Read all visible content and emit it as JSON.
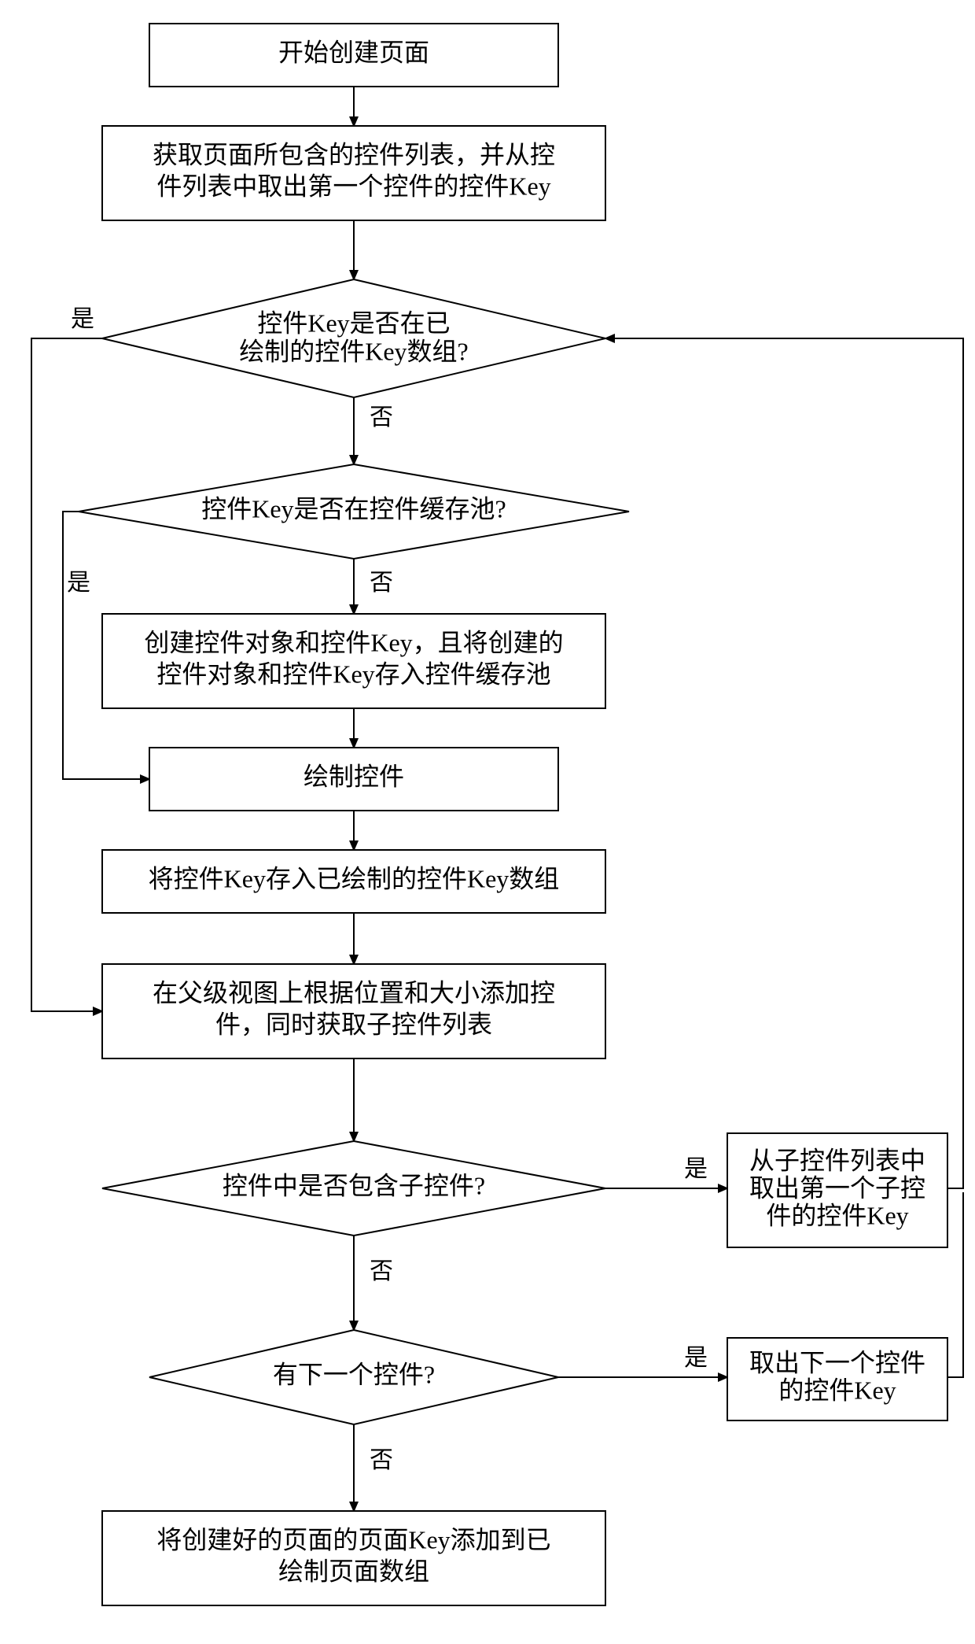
{
  "nodes": {
    "start": {
      "l1": "开始创建页面"
    },
    "getlist": {
      "l1": "获取页面所包含的控件列表，并从控",
      "l2": "件列表中取出第一个控件的控件Key"
    },
    "d_drawn": {
      "l1": "控件Key是否在已",
      "l2": "绘制的控件Key数组?"
    },
    "d_cache": {
      "l1": "控件Key是否在控件缓存池?"
    },
    "create": {
      "l1": "创建控件对象和控件Key，且将创建的",
      "l2": "控件对象和控件Key存入控件缓存池"
    },
    "draw": {
      "l1": "绘制控件"
    },
    "storekey": {
      "l1": "将控件Key存入已绘制的控件Key数组"
    },
    "addparent": {
      "l1": "在父级视图上根据位置和大小添加控",
      "l2": "件，同时获取子控件列表"
    },
    "d_child": {
      "l1": "控件中是否包含子控件?"
    },
    "takechild": {
      "l1": "从子控件列表中",
      "l2": "取出第一个子控",
      "l3": "件的控件Key"
    },
    "d_next": {
      "l1": "有下一个控件?"
    },
    "takenext": {
      "l1": "取出下一个控件",
      "l2": "的控件Key"
    },
    "finish": {
      "l1": "将创建好的页面的页面Key添加到已",
      "l2": "绘制页面数组"
    }
  },
  "labels": {
    "yes": "是",
    "no": "否"
  }
}
